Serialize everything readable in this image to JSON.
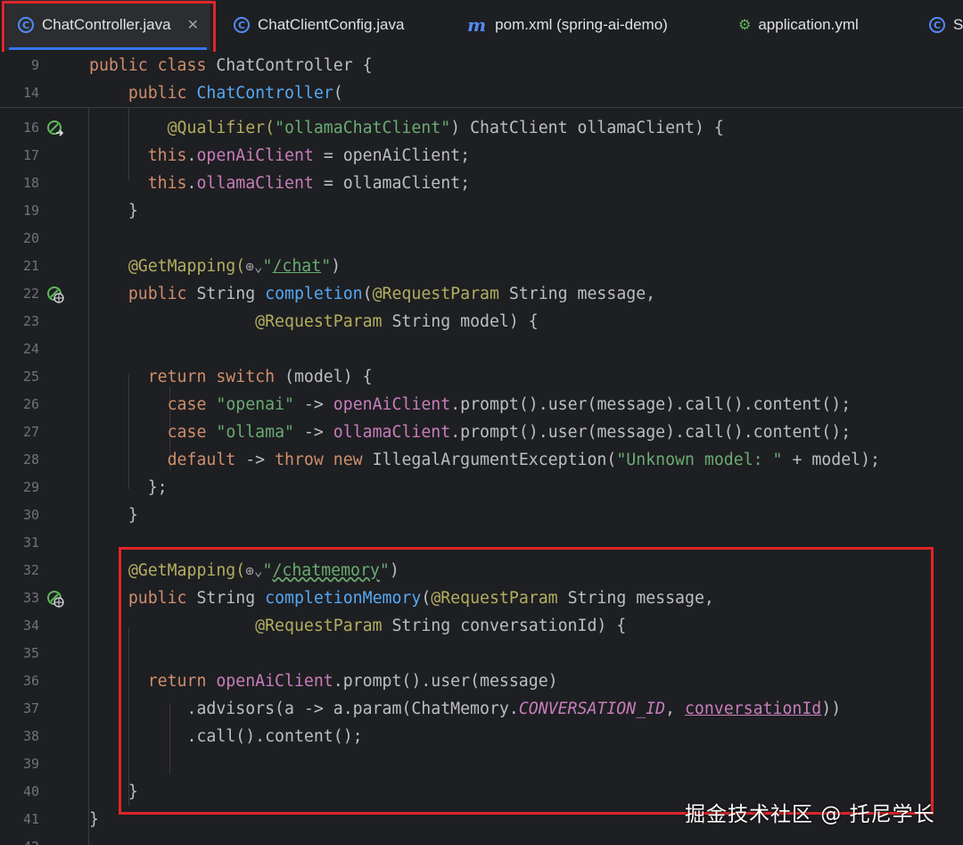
{
  "tabs": [
    {
      "label": "ChatController.java",
      "icon": "class-icon",
      "active": true
    },
    {
      "label": "ChatClientConfig.java",
      "icon": "class-icon"
    },
    {
      "label": "pom.xml (spring-ai-demo)",
      "icon": "maven-icon"
    },
    {
      "label": "application.yml",
      "icon": "yaml-icon"
    },
    {
      "label": "Sp",
      "icon": "class-icon"
    }
  ],
  "sticky": {
    "line9_num": "9",
    "line9_kw1": "public",
    "line9_kw2": "class",
    "line9_name": "ChatController {",
    "line14_num": "14",
    "line14_kw": "public",
    "line14_fn": "ChatController",
    "line14_paren": "("
  },
  "lines": {
    "l16": {
      "num": "16",
      "ann": "@Qualifier(",
      "str": "\"ollamaChatClient\"",
      "rest": ") ChatClient ollamaClient) {"
    },
    "l17": {
      "num": "17",
      "kw": "this",
      "dot": ".",
      "fld": "openAiClient",
      "rest": " = openAiClient;"
    },
    "l18": {
      "num": "18",
      "kw": "this",
      "dot": ".",
      "fld": "ollamaClient",
      "rest": " = ollamaClient;"
    },
    "l19": {
      "num": "19",
      "text": "}"
    },
    "l20": {
      "num": "20"
    },
    "l21": {
      "num": "21",
      "ann": "@GetMapping(",
      "globe": "⊕⌄",
      "str_q1": "\"",
      "str_path": "/chat",
      "str_q2": "\"",
      "rest": ")"
    },
    "l22": {
      "num": "22",
      "kw": "public",
      "type": " String ",
      "fn": "completion",
      "p1": "(",
      "ann": "@RequestParam",
      "rest": " String message,"
    },
    "l23": {
      "num": "23",
      "ann": "@RequestParam",
      "rest": " String model) {"
    },
    "l24": {
      "num": "24"
    },
    "l25": {
      "num": "25",
      "kw1": "return",
      "kw2": "switch",
      "rest": " (model) {"
    },
    "l26": {
      "num": "26",
      "kw": "case",
      "str": "\"openai\"",
      "arrow": " -> ",
      "fld": "openAiClient",
      "rest": ".prompt().user(message).call().content();"
    },
    "l27": {
      "num": "27",
      "kw": "case",
      "str": "\"ollama\"",
      "arrow": " -> ",
      "fld": "ollamaClient",
      "rest": ".prompt().user(message).call().content();"
    },
    "l28": {
      "num": "28",
      "kw1": "default",
      "arrow": " -> ",
      "kw2": "throw",
      "kw3": "new",
      "mid": " IllegalArgumentException(",
      "str": "\"Unknown model: \"",
      "rest": " + model);"
    },
    "l29": {
      "num": "29",
      "text": "};"
    },
    "l30": {
      "num": "30",
      "text": "}"
    },
    "l31": {
      "num": "31"
    },
    "l32": {
      "num": "32",
      "ann": "@GetMapping(",
      "globe": "⊕⌄",
      "str_q1": "\"",
      "str_path": "/chatmemory",
      "str_q2": "\"",
      "rest": ")"
    },
    "l33": {
      "num": "33",
      "kw": "public",
      "type": " String ",
      "fn": "completionMemory",
      "p1": "(",
      "ann": "@RequestParam",
      "rest": " String message,"
    },
    "l34": {
      "num": "34",
      "ann": "@RequestParam",
      "rest": " String conversationId) {"
    },
    "l35": {
      "num": "35"
    },
    "l36": {
      "num": "36",
      "kw": "return",
      "fld": "openAiClient",
      "rest": ".prompt().user(message)"
    },
    "l37": {
      "num": "37",
      "pre": ".advisors(a -> a.param(ChatMemory.",
      "const": "CONVERSATION_ID",
      "mid": ", ",
      "ul": "conversationId",
      "rest": "))"
    },
    "l38": {
      "num": "38",
      "text": ".call().content();"
    },
    "l39": {
      "num": "39"
    },
    "l40": {
      "num": "40",
      "text": "}"
    },
    "l41": {
      "num": "41",
      "text": "}"
    },
    "l42": {
      "num": "42"
    }
  },
  "watermark": "掘金技术社区 @ 托尼学长"
}
